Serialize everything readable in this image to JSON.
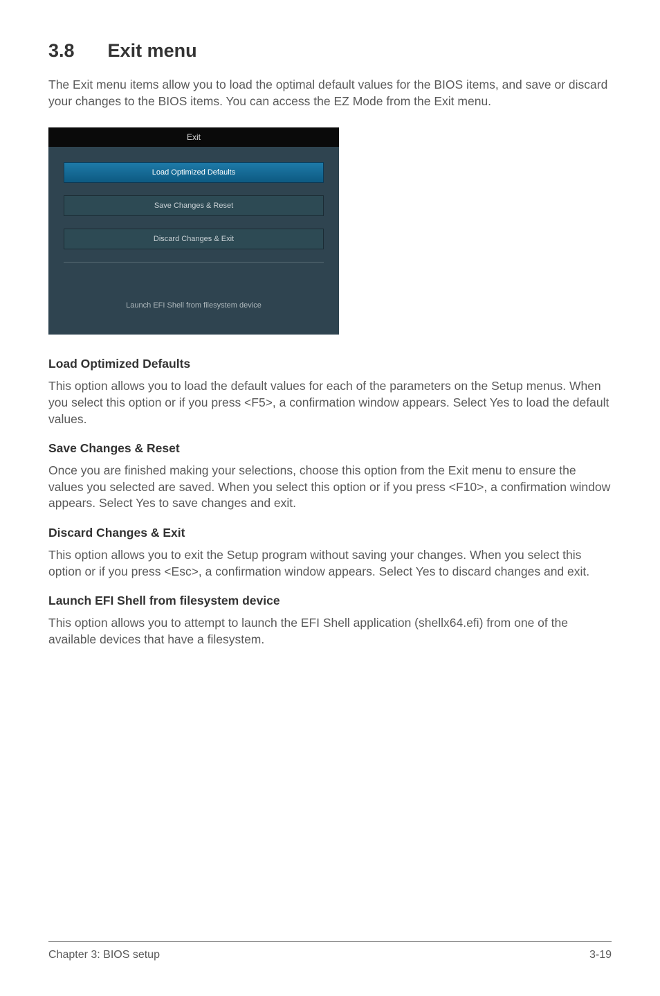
{
  "section": {
    "num": "3.8",
    "title": "Exit menu"
  },
  "intro": "The Exit menu items allow you to load the optimal default values for the BIOS items, and save or discard your changes to the BIOS items. You can access the EZ Mode from the Exit menu.",
  "bios": {
    "title": "Exit",
    "btn_load": "Load Optimized Defaults",
    "btn_save": "Save Changes & Reset",
    "btn_discard": "Discard Changes & Exit",
    "launch": "Launch EFI Shell from filesystem device"
  },
  "sec1": {
    "head": "Load Optimized Defaults",
    "body": "This option allows you to load the default values for each of the parameters on the Setup menus. When you select this option or if you press <F5>, a confirmation window appears. Select Yes to load the default values."
  },
  "sec2": {
    "head": "Save Changes & Reset",
    "body": "Once you are finished making your selections, choose this option from the Exit menu to ensure the values you selected are saved. When you select this option or if you press <F10>, a confirmation window appears. Select Yes to save changes and exit."
  },
  "sec3": {
    "head": "Discard Changes & Exit",
    "body": "This option allows you to exit the Setup program without saving your changes. When you select this option or if you press <Esc>, a confirmation window appears. Select Yes to discard changes and exit."
  },
  "sec4": {
    "head": "Launch EFI Shell from filesystem device",
    "body": "This option allows you to attempt to launch the EFI Shell application (shellx64.efi) from one of the available devices that have a filesystem."
  },
  "footer": {
    "chapter": "Chapter 3: BIOS setup",
    "page": "3-19"
  }
}
